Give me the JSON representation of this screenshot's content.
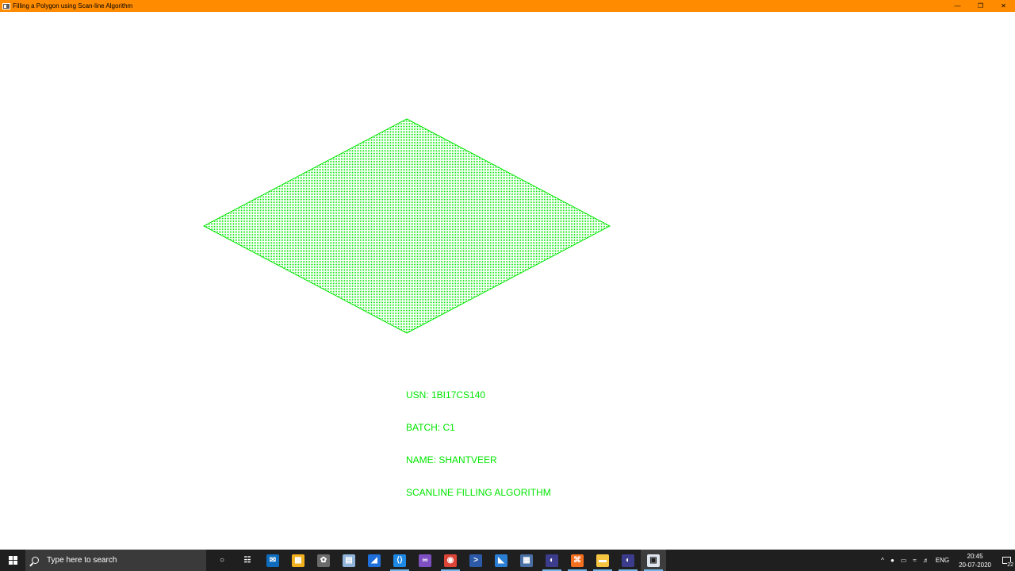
{
  "window": {
    "title": "Filling a Polygon using Scan-line Algorithm",
    "controls": {
      "minimize": "—",
      "restore": "❐",
      "close": "✕"
    }
  },
  "canvas": {
    "polygon_color": "#00e600",
    "info": {
      "usn": "USN: 1BI17CS140",
      "batch": "BATCH: C1",
      "name": "NAME: SHANTVEER",
      "algorithm": "SCANLINE FILLING ALGORITHM"
    }
  },
  "taskbar": {
    "search_placeholder": "Type here to search",
    "icons": [
      {
        "name": "cortana-icon",
        "glyph": "○",
        "bg": "transparent",
        "running": false
      },
      {
        "name": "task-view-icon",
        "glyph": "☷",
        "bg": "transparent",
        "running": false
      },
      {
        "name": "mail-icon",
        "glyph": "✉",
        "bg": "#0f6cbd",
        "running": false
      },
      {
        "name": "store-icon",
        "glyph": "▦",
        "bg": "#f2b01e",
        "running": false
      },
      {
        "name": "paint-icon",
        "glyph": "✿",
        "bg": "#6b6b6b",
        "running": false
      },
      {
        "name": "notes-icon",
        "glyph": "▤",
        "bg": "#8fb3d9",
        "running": false
      },
      {
        "name": "whiteboard-icon",
        "glyph": "◢",
        "bg": "#1e6fd9",
        "running": false
      },
      {
        "name": "vscode-icon",
        "glyph": "⟨⟩",
        "bg": "#1e88e5",
        "running": true
      },
      {
        "name": "visual-studio-icon",
        "glyph": "∞",
        "bg": "#7e4fc0",
        "running": false
      },
      {
        "name": "chrome-icon",
        "glyph": "◉",
        "bg": "#db4437",
        "running": true
      },
      {
        "name": "powershell-icon",
        "glyph": ">",
        "bg": "#2d5aa8",
        "running": false
      },
      {
        "name": "remote-icon",
        "glyph": "◣",
        "bg": "#2a7fd4",
        "running": false
      },
      {
        "name": "calculator-icon",
        "glyph": "▦",
        "bg": "#4a6fa5",
        "running": false
      },
      {
        "name": "eclipse-icon",
        "glyph": "◐",
        "bg": "#3c3c8c",
        "running": true
      },
      {
        "name": "xampp-icon",
        "glyph": "⌘",
        "bg": "#f37021",
        "running": true
      },
      {
        "name": "file-explorer-icon",
        "glyph": "▬",
        "bg": "#f5c542",
        "running": true
      },
      {
        "name": "eclipse-2-icon",
        "glyph": "◐",
        "bg": "#3c3c8c",
        "running": true
      },
      {
        "name": "opengl-app-icon",
        "glyph": "▣",
        "bg": "#dfe6ee",
        "running": true,
        "active": true
      }
    ],
    "tray": {
      "language": "ENG",
      "time": "20:45",
      "date": "20-07-2020",
      "notification_count": "22"
    }
  }
}
